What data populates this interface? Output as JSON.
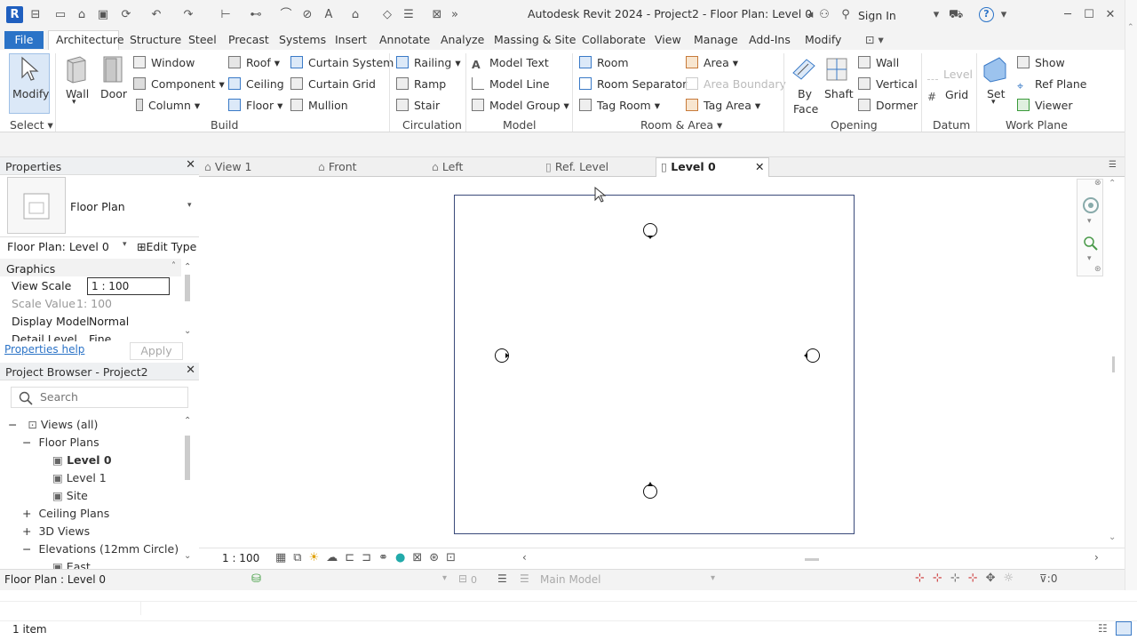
{
  "app": {
    "logo": "R",
    "title": "Autodesk Revit 2024 - Project2 - Floor Plan: Level 0",
    "sign_in": "Sign In",
    "help": "?"
  },
  "ribbon_tabs": [
    "File",
    "Architecture",
    "Structure",
    "Steel",
    "Precast",
    "Systems",
    "Insert",
    "Annotate",
    "Analyze",
    "Massing & Site",
    "Collaborate",
    "View",
    "Manage",
    "Add-Ins",
    "Modify"
  ],
  "ribbon": {
    "modify": "Modify",
    "wall": "Wall",
    "door": "Door",
    "window": "Window",
    "component": "Component",
    "column": "Column",
    "roof": "Roof",
    "ceiling": "Ceiling",
    "floor": "Floor",
    "curtain_system": "Curtain  System",
    "curtain_grid": "Curtain  Grid",
    "mullion": "Mullion",
    "railing": "Railing",
    "ramp": "Ramp",
    "stair": "Stair",
    "model_text": "Model  Text",
    "model_line": "Model  Line",
    "model_group": "Model  Group",
    "room": "Room",
    "room_separator": "Room  Separator",
    "tag_room": "Tag  Room",
    "area": "Area",
    "area_boundary": "Area  Boundary",
    "tag_area": "Tag  Area",
    "by_face_1": "By",
    "by_face_2": "Face",
    "shaft": "Shaft",
    "wall_opening": "Wall",
    "vertical": "Vertical",
    "dormer": "Dormer",
    "level": "Level",
    "grid": "Grid",
    "set": "Set",
    "show": "Show",
    "ref_plane": "Ref  Plane",
    "viewer": "Viewer",
    "groups": {
      "select": "Select",
      "build": "Build",
      "circulation": "Circulation",
      "model": "Model",
      "room_area": "Room & Area",
      "opening": "Opening",
      "datum": "Datum",
      "work_plane": "Work Plane"
    }
  },
  "properties": {
    "title": "Properties",
    "type_name": "Floor Plan",
    "instance": "Floor Plan: Level 0",
    "edit_type": "Edit Type",
    "section": "Graphics",
    "rows": [
      {
        "label": "View Scale",
        "value": "1 : 100"
      },
      {
        "label": "Scale Value",
        "value": "1:  100"
      },
      {
        "label": "Display Model",
        "value": "Normal"
      },
      {
        "label": "Detail Level",
        "value": "Fine"
      }
    ],
    "help": "Properties help",
    "apply": "Apply"
  },
  "browser": {
    "title": "Project Browser - Project2",
    "search_placeholder": "Search",
    "items": [
      "Views (all)",
      "Floor Plans",
      "Level 0",
      "Level 1",
      "Site",
      "Ceiling Plans",
      "3D Views",
      "Elevations (12mm Circle)",
      "East"
    ]
  },
  "view_tabs": [
    "View 1",
    "Front",
    "Left",
    "Ref. Level",
    "Level 0"
  ],
  "view_control": {
    "scale": "1 : 100"
  },
  "status": {
    "left": "Floor Plan : Level 0",
    "workset": "0",
    "model": "Main Model",
    "filter": ":0"
  },
  "bottom": {
    "selection": "1 item"
  }
}
